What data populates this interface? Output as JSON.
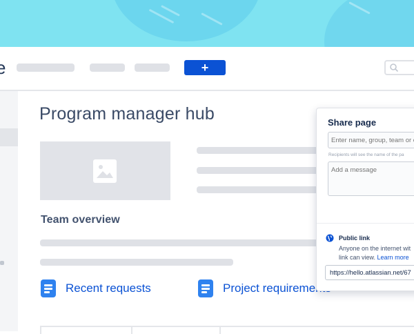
{
  "header": {
    "logo_fragment": "e",
    "create_button_label": "+"
  },
  "page": {
    "title": "Program manager hub",
    "section_title": "Team overview",
    "links": [
      {
        "label": "Recent requests"
      },
      {
        "label": "Project requirements"
      }
    ]
  },
  "share_dialog": {
    "title": "Share page",
    "recipients_placeholder": "Enter name, group, team or e",
    "recipients_hint": "Recipients will see the name of the pa",
    "message_placeholder": "Add a message",
    "public_link": {
      "title": "Public link",
      "description_line1": "Anyone on the internet wit",
      "description_line2": "link can view.",
      "learn_more": "Learn more",
      "url": "https://hello.atlassian.net/67"
    }
  },
  "icons": {
    "create": "plus-icon",
    "search": "search-icon",
    "image": "image-placeholder-icon",
    "document": "document-icon",
    "globe": "globe-icon"
  },
  "colors": {
    "hero": "#7fe3f1",
    "primary": "#0b52d4",
    "doc_icon": "#2f82ef",
    "title": "#3a4a66"
  }
}
